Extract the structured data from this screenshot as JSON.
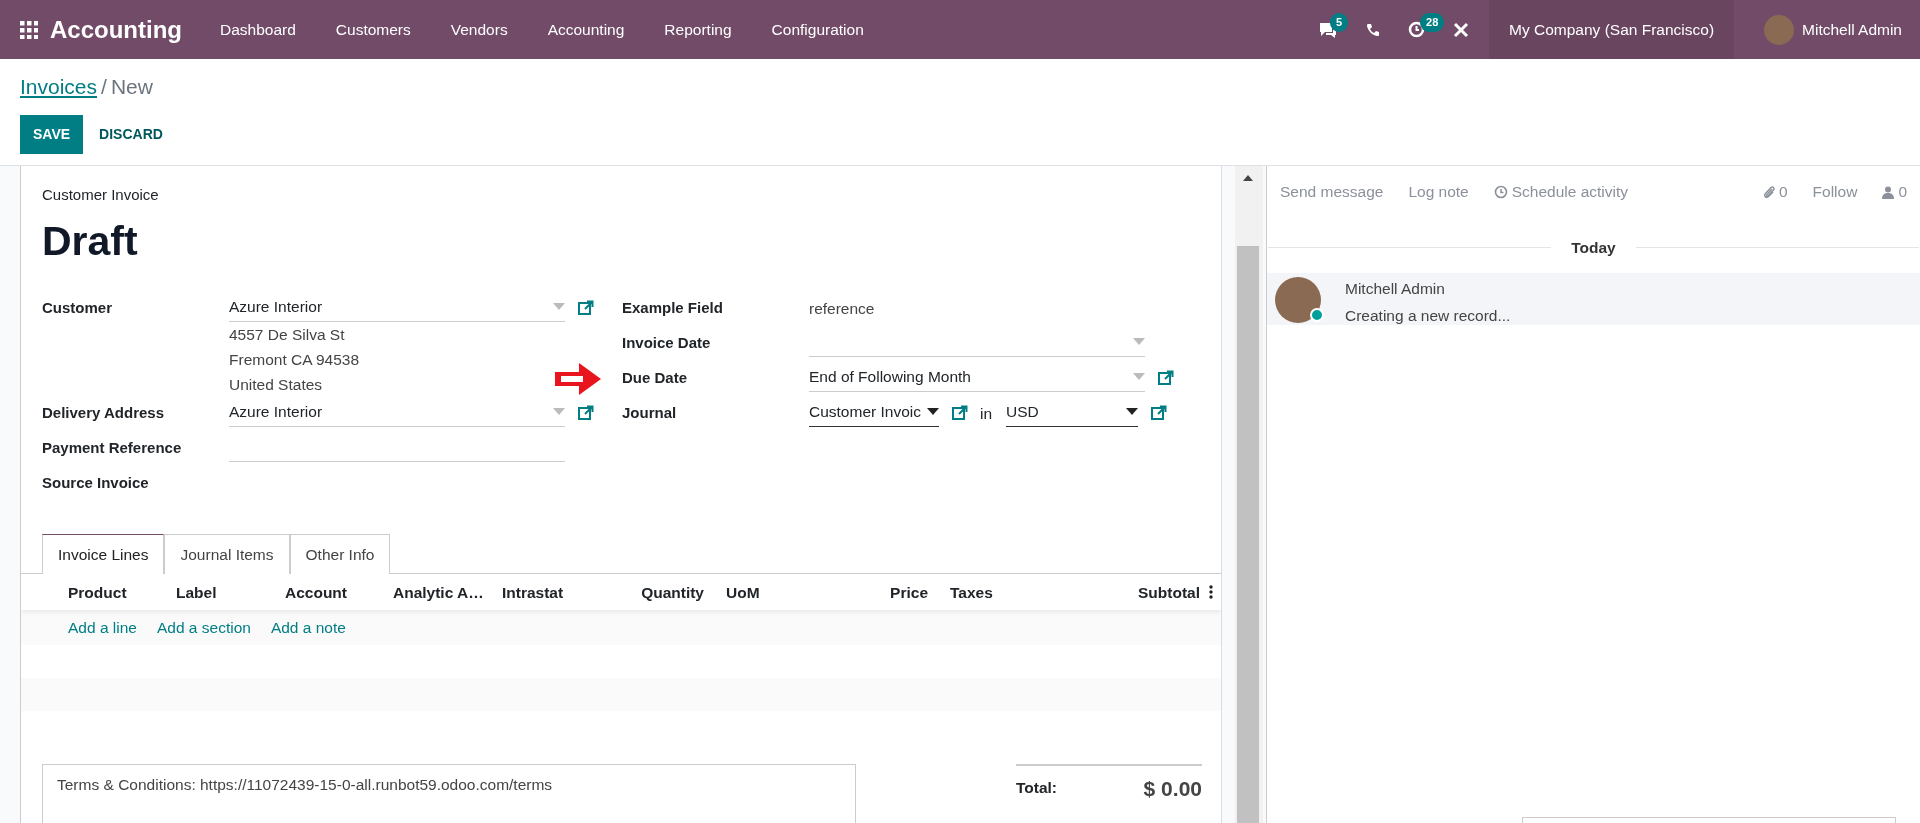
{
  "navbar": {
    "app_name": "Accounting",
    "menu": [
      "Dashboard",
      "Customers",
      "Vendors",
      "Accounting",
      "Reporting",
      "Configuration"
    ],
    "messages_badge": "5",
    "activity_badge": "28",
    "company": "My Company (San Francisco)",
    "user": "Mitchell Admin"
  },
  "breadcrumb": {
    "parent": "Invoices",
    "separator": "/",
    "current": "New"
  },
  "buttons": {
    "save": "SAVE",
    "discard": "DISCARD"
  },
  "form": {
    "subtitle": "Customer Invoice",
    "title": "Draft",
    "left_fields": [
      {
        "label": "Customer",
        "kind": "many2one",
        "value": "Azure Interior",
        "address_lines": [
          "4557 De Silva St",
          "Fremont CA 94538",
          "United States"
        ]
      },
      {
        "label": "Delivery Address",
        "kind": "many2one",
        "value": "Azure Interior"
      },
      {
        "label": "Payment Reference",
        "kind": "input"
      },
      {
        "label": "Source Invoice",
        "kind": "none"
      }
    ],
    "right_fields": [
      {
        "label": "Example Field",
        "kind": "readonly",
        "value": "reference",
        "pointed": false
      },
      {
        "label": "Invoice Date",
        "kind": "date",
        "pointed": false
      },
      {
        "label": "Due Date",
        "kind": "many2one",
        "value": "End of Following Month",
        "pointed": true
      },
      {
        "label": "Journal",
        "kind": "journal",
        "value": "Customer Invoic",
        "connector": "in",
        "currency": "USD",
        "pointed": false
      }
    ],
    "tabs": [
      {
        "label": "Invoice Lines",
        "selected": true
      },
      {
        "label": "Journal Items",
        "selected": false
      },
      {
        "label": "Other Info",
        "selected": false
      }
    ],
    "columns": [
      "Product",
      "Label",
      "Account",
      "Analytic A…",
      "Intrastat",
      "Quantity",
      "UoM",
      "Price",
      "Taxes",
      "Subtotal"
    ],
    "add_links": [
      "Add a line",
      "Add a section",
      "Add a note"
    ],
    "terms": "Terms & Conditions: https://11072439-15-0-all.runbot59.odoo.com/terms",
    "total_label": "Total:",
    "total_value": "$ 0.00"
  },
  "chatter": {
    "actions": [
      "Send message",
      "Log note",
      "Schedule activity"
    ],
    "attachments": "0",
    "follow": "Follow",
    "followers": "0",
    "date_separator": "Today",
    "messages": [
      {
        "author": "Mitchell Admin",
        "body": "Creating a new record...",
        "online": true
      }
    ]
  }
}
